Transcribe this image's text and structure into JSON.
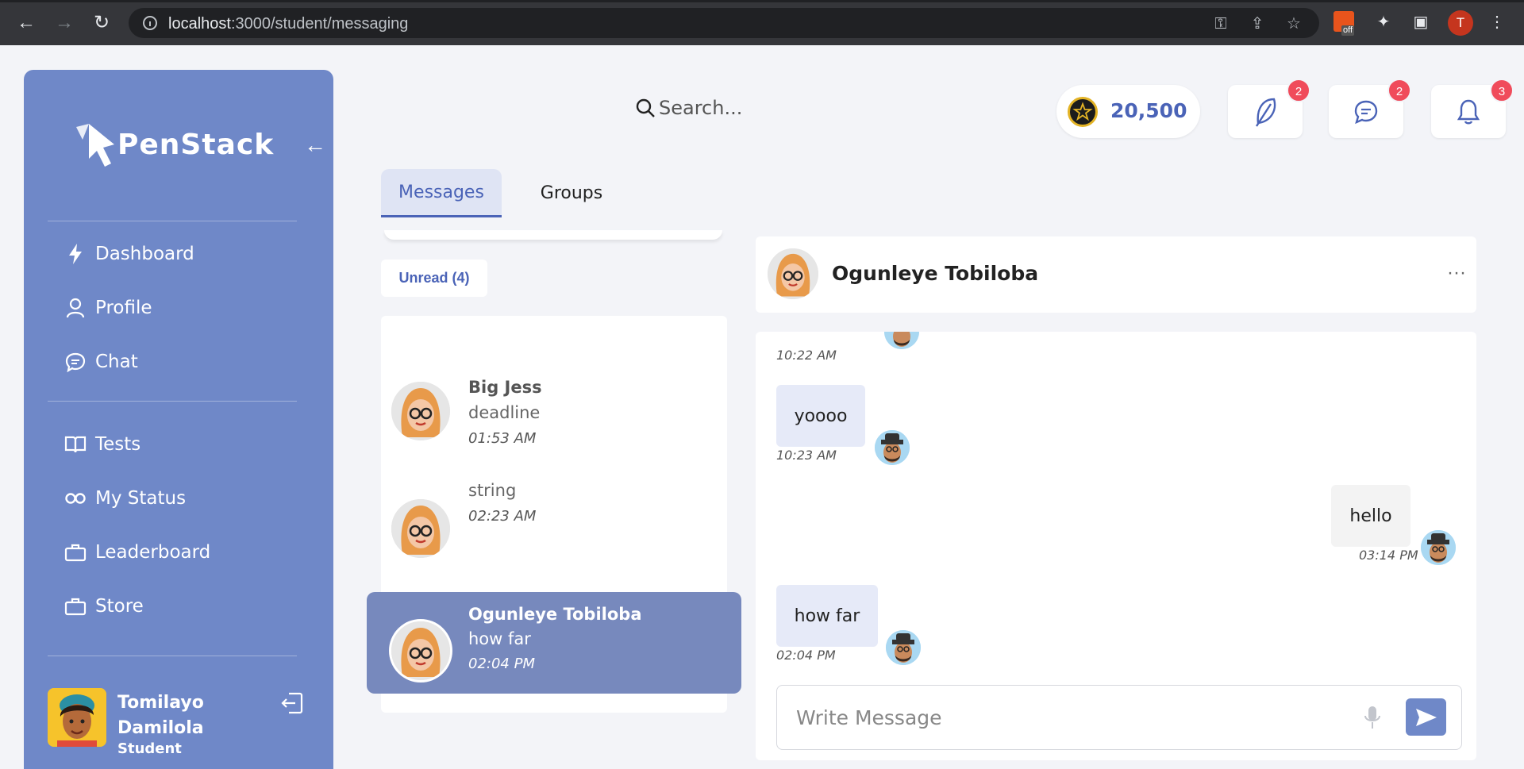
{
  "browser": {
    "url_host": "localhost",
    "url_path": ":3000/student/messaging",
    "profile_initial": "T",
    "ext_badge": "off"
  },
  "sidebar": {
    "brand": "PenStack",
    "nav": [
      {
        "label": "Dashboard",
        "icon": "bolt-icon"
      },
      {
        "label": "Profile",
        "icon": "user-icon"
      },
      {
        "label": "Chat",
        "icon": "chat-icon"
      },
      {
        "label": "Tests",
        "icon": "book-icon"
      },
      {
        "label": "My Status",
        "icon": "infinity-icon"
      },
      {
        "label": "Leaderboard",
        "icon": "briefcase-icon"
      },
      {
        "label": "Store",
        "icon": "briefcase-icon"
      }
    ],
    "user": {
      "first": "Tomilayo",
      "last": "Damilola",
      "role": "Student"
    }
  },
  "header": {
    "search_placeholder": "Search...",
    "coins": "20,500",
    "badges": {
      "feather": "2",
      "messages": "2",
      "notifications": "3"
    }
  },
  "tabs": [
    {
      "label": "Messages",
      "active": true
    },
    {
      "label": "Groups",
      "active": false
    }
  ],
  "filter": {
    "unread_label": "Unread (4)"
  },
  "conversations": [
    {
      "name": "Big Jess",
      "message": "deadline",
      "time": "01:53 AM",
      "active": false
    },
    {
      "name": "",
      "message": "string",
      "time": "02:23 AM",
      "active": false
    },
    {
      "name": "Ogunleye Tobiloba",
      "message": "how far",
      "time": "02:04 PM",
      "active": true
    }
  ],
  "chat": {
    "title": "Ogunleye Tobiloba",
    "messages": [
      {
        "text": "",
        "time": "10:22 AM",
        "mine": false
      },
      {
        "text": "yoooo",
        "time": "10:23 AM",
        "mine": false
      },
      {
        "text": "hello",
        "time": "03:14 PM",
        "mine": true
      },
      {
        "text": "how far",
        "time": "02:04 PM",
        "mine": false
      }
    ],
    "compose_placeholder": "Write Message"
  },
  "colors": {
    "sidebar": "#6f88c8",
    "accent": "#4a63b7",
    "active_conversation": "#7789bd",
    "badge": "#f04b5b"
  }
}
